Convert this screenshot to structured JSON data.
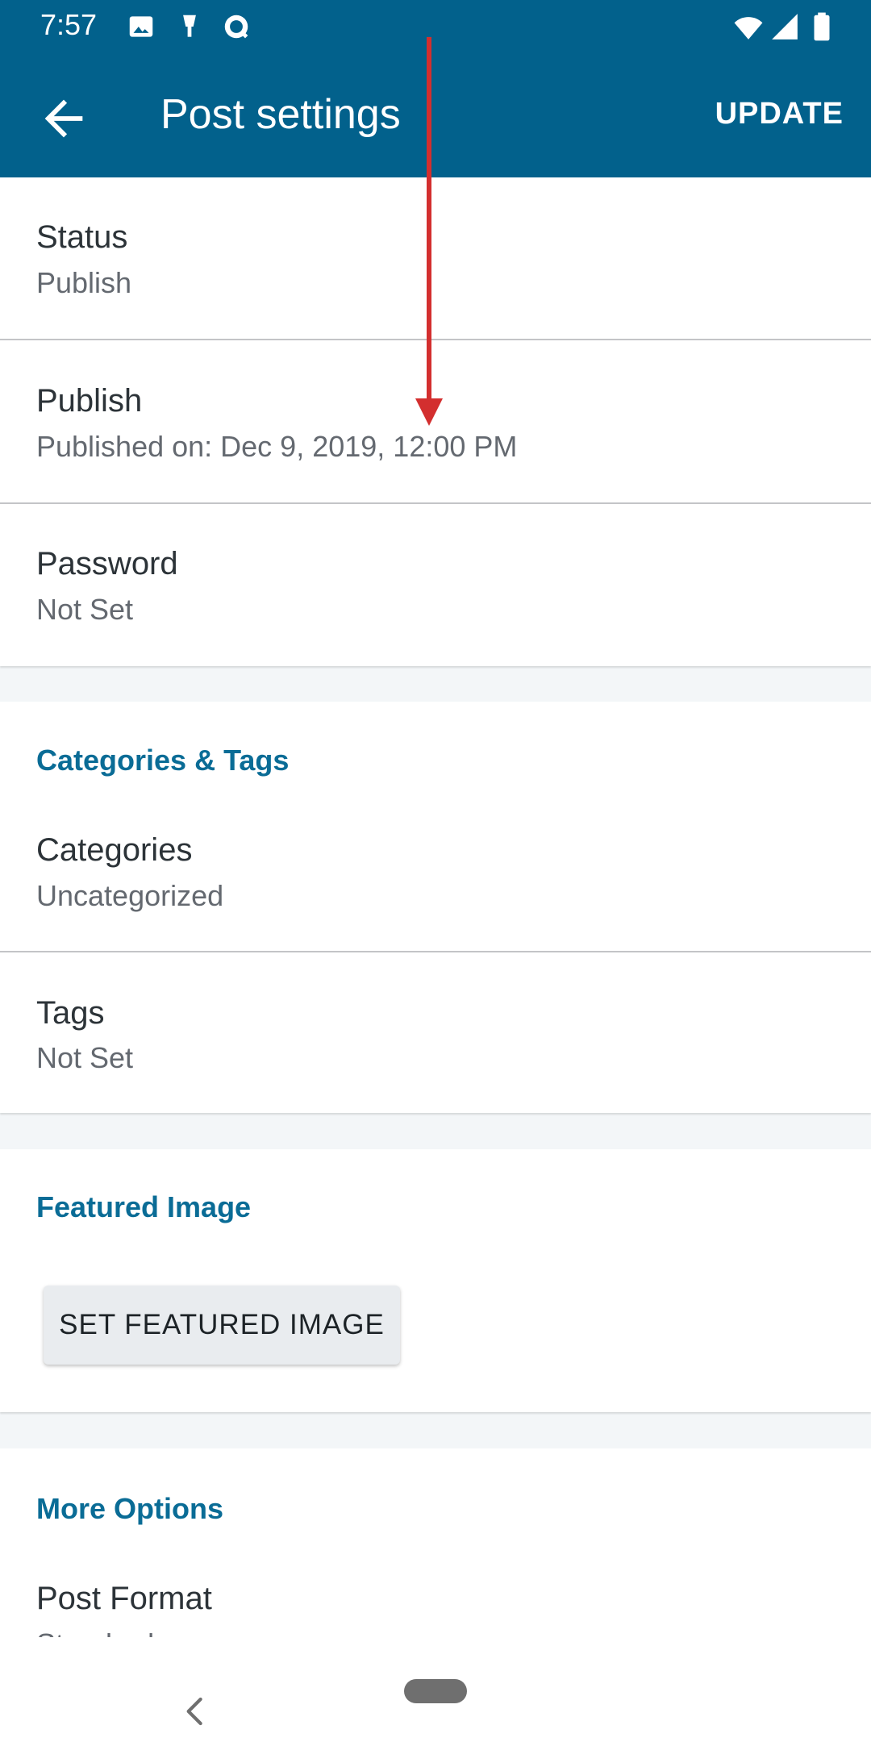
{
  "status_bar": {
    "time": "7:57",
    "icons_left": [
      "image-icon",
      "beverage-icon",
      "money-app-icon"
    ],
    "icons_right": [
      "wifi-icon",
      "cellular-signal-icon",
      "battery-icon"
    ]
  },
  "toolbar": {
    "title": "Post settings",
    "action_label": "UPDATE",
    "back_icon": "back-arrow-icon"
  },
  "publish_card": {
    "rows": [
      {
        "title": "Status",
        "value": "Publish"
      },
      {
        "title": "Publish",
        "value": "Published on: Dec 9, 2019, 12:00 PM"
      },
      {
        "title": "Password",
        "value": "Not Set"
      }
    ]
  },
  "categories_card": {
    "section_title": "Categories & Tags",
    "rows": [
      {
        "title": "Categories",
        "value": "Uncategorized"
      },
      {
        "title": "Tags",
        "value": "Not Set"
      }
    ]
  },
  "featured_card": {
    "section_title": "Featured Image",
    "button_label": "SET FEATURED IMAGE"
  },
  "more_options_card": {
    "section_title": "More Options",
    "rows": [
      {
        "title": "Post Format",
        "value": "Standard"
      }
    ]
  },
  "colors": {
    "appbar": "#02618c",
    "section_title": "#0a6c96",
    "annotation_arrow": "#d32f2f"
  }
}
